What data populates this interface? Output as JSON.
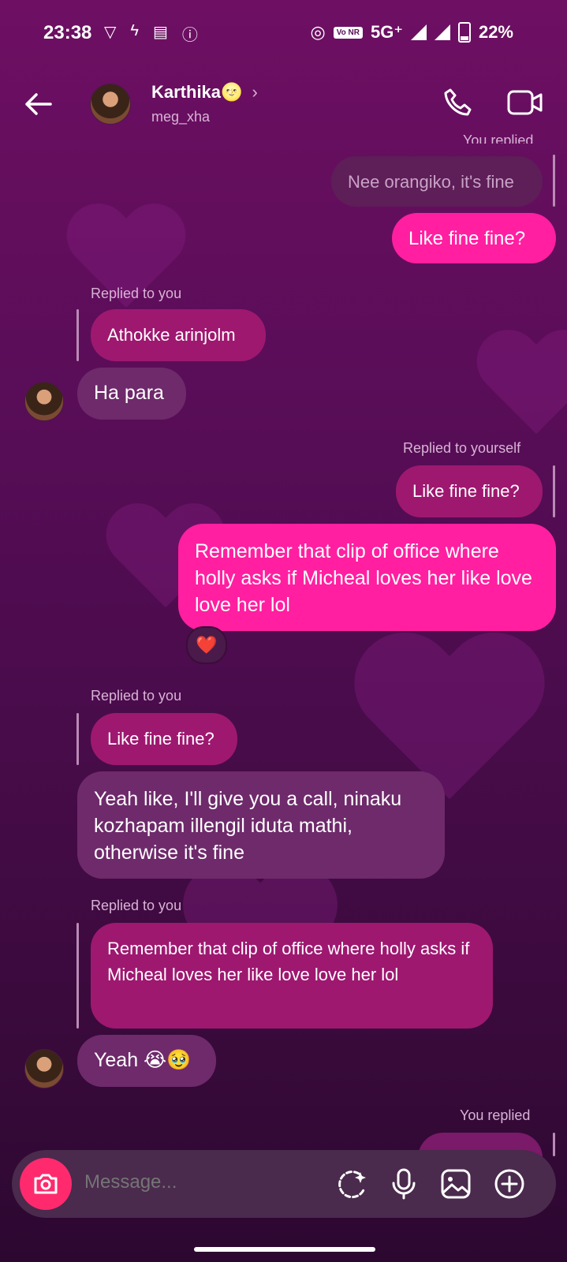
{
  "status": {
    "time": "23:38",
    "network": "5G⁺",
    "volte": "Vo NR",
    "battery": "22%"
  },
  "header": {
    "name": "Karthika🌝",
    "username": "meg_xha",
    "chevron": "›"
  },
  "messages": {
    "top_partial_label": "You replied",
    "m1_quote": "Nee orangiko, it's fine",
    "m1_reply": "Like fine fine?",
    "m2_meta": "Replied to you",
    "m2_quote": "Athokke arinjolm",
    "m2_text": "Ha para",
    "m3_meta": "Replied to yourself",
    "m3_quote": "Like fine fine?",
    "m3_text": "Remember that clip of office where holly asks if Micheal loves her like love love her lol",
    "m3_reaction": "❤️",
    "m4_meta": "Replied to you",
    "m4_quote": "Like fine fine?",
    "m4_text": "Yeah like, I'll give you a call, ninaku kozhapam illengil iduta mathi, otherwise it's fine",
    "m5_meta": "Replied to you",
    "m5_quote": "Remember that clip of office where holly asks if Micheal loves her like love love her lol",
    "m5_text": "Yeah 😭🥹",
    "m6_meta": "You replied"
  },
  "composer": {
    "placeholder": "Message..."
  },
  "colors": {
    "accent_pink": "#ff1fa0",
    "camera": "#ff2a6e",
    "theirs_bubble": "#6e2a6b",
    "quote_bubble": "#9e1870"
  }
}
